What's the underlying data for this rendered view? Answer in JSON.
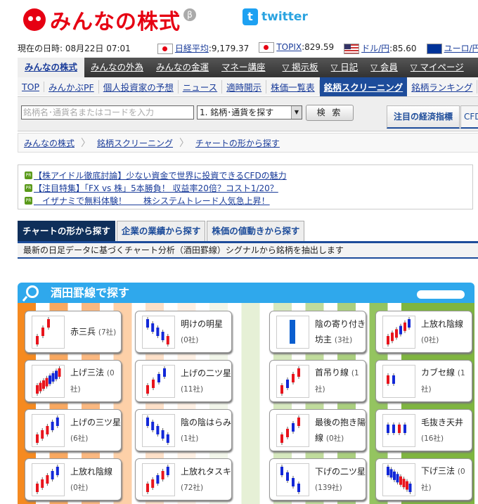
{
  "header": {
    "logo_text": "みんなの株式",
    "beta": "β",
    "twitter": "twitter",
    "twitter_icon": "t"
  },
  "ticker": {
    "datetime_label": "現在の日時:",
    "datetime": "08月22日 07:01",
    "items": [
      {
        "flag": "jp",
        "name": "日経平均",
        "value": ":9,179.37"
      },
      {
        "flag": "jp",
        "name": "TOPIX",
        "value": ":829.59"
      },
      {
        "flag": "us",
        "name": "ドル/円",
        "value": ":85.60"
      },
      {
        "flag": "eu",
        "name": "ユーロ/円",
        "value": ""
      }
    ]
  },
  "nav": [
    "みんなの株式",
    "みんなの外為",
    "みんなの金運",
    "マネー講座",
    "▽ 掲示板",
    "▽ 日記",
    "▽ 会員",
    "▽ マイページ"
  ],
  "subnav": [
    "TOP",
    "みんかぶPF",
    "個人投資家の予想",
    "ニュース",
    "適時開示",
    "株価一覧表",
    "銘柄スクリーニング",
    "銘柄ランキング"
  ],
  "search": {
    "placeholder": "銘柄名･通貨名またはコードを入力",
    "select": "1. 銘柄･通貨を探す",
    "button": "検 索",
    "tab1": "注目の経済指標",
    "tab2": "CFD"
  },
  "breadcrumb": [
    "みんなの株式",
    "銘柄スクリーニング",
    "チャートの形から探す"
  ],
  "pr": {
    "badge": "PR",
    "links": [
      "【株アイドル徹底討論】少ない資金で世界に投資できるCFDの魅力",
      "【注目特集】「FX vs 株」5本勝負！ 収益率20倍？コスト1/20？",
      "　イザナミで無料体験！　　株システムトレード人気急上昇！"
    ]
  },
  "tabs": [
    "チャートの形から探す",
    "企業の業績から探す",
    "株価の値動きから探す"
  ],
  "description": "最新の日足データに基づくチャート分析（酒田罫線）シグナルから銘柄を抽出します",
  "panel": {
    "title": "酒田罫線で探す",
    "cards": [
      {
        "name": "赤三兵",
        "count": "(7社)",
        "candles": "rrr",
        "trend": "up"
      },
      {
        "name": "明けの明星",
        "count": "(0社)",
        "candles": "bbbbr",
        "trend": "down"
      },
      {
        "name": "陰の寄り付き坊主",
        "count": "(3社)",
        "candles": "B",
        "trend": "flat"
      },
      {
        "name": "上放れ陰線",
        "count": "(0社)",
        "candles": "rrrbrb",
        "trend": "up"
      },
      {
        "name": "上げ三法",
        "count": "(0社)",
        "candles": "rrrrbbbr",
        "trend": "up"
      },
      {
        "name": "上げの二ツ星",
        "count": "(11社)",
        "candles": "rrbb",
        "trend": "up"
      },
      {
        "name": "首吊り線",
        "count": "(1社)",
        "candles": "rbrr",
        "trend": "up"
      },
      {
        "name": "カブセ線",
        "count": "(1社)",
        "candles": "rb",
        "trend": "flat"
      },
      {
        "name": "上げの三ツ星",
        "count": "(6社)",
        "candles": "rrrbb",
        "trend": "up"
      },
      {
        "name": "陰の陰はらみ",
        "count": "(1社)",
        "candles": "bbbbb",
        "trend": "down"
      },
      {
        "name": "最後の抱き陽線",
        "count": "(0社)",
        "candles": "rrbr",
        "trend": "up"
      },
      {
        "name": "毛抜き天井",
        "count": "(16社)",
        "candles": "bbrb",
        "trend": "flat"
      },
      {
        "name": "上放れ陰線",
        "count": "(0社)",
        "candles": "rrrbb",
        "trend": "up"
      },
      {
        "name": "上放れタスキ",
        "count": "(72社)",
        "candles": "rrbrb",
        "trend": "up"
      },
      {
        "name": "下げの二ツ星",
        "count": "(139社)",
        "candles": "bbbb",
        "trend": "down"
      },
      {
        "name": "下げ三法",
        "count": "(0社)",
        "candles": "bbbbrrrb",
        "trend": "down"
      }
    ]
  },
  "colors": {
    "up": "#e8141c",
    "down": "#1228d8",
    "accent": "#1d4c9a",
    "panel": "#2fa8ec"
  }
}
